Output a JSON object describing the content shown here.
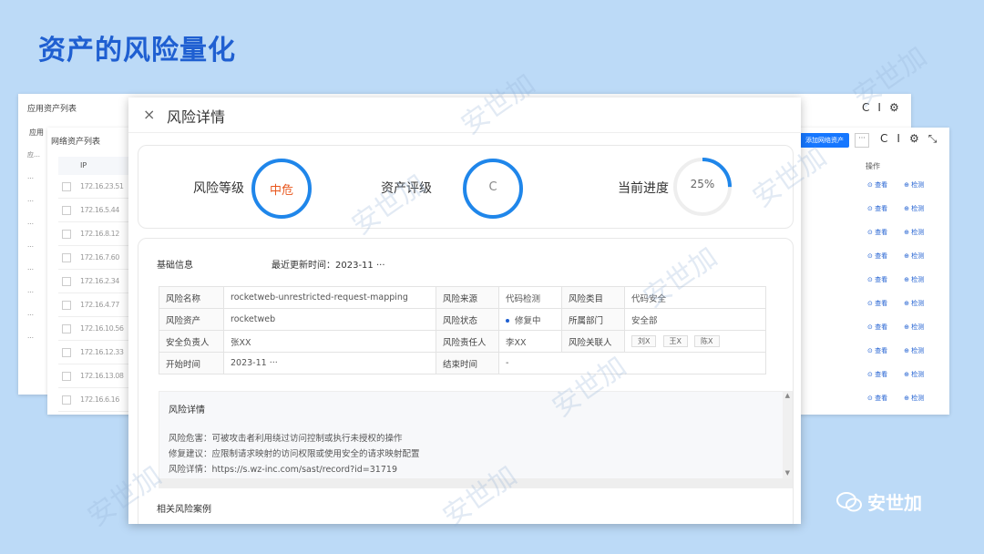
{
  "slide_title": "资产的风险量化",
  "app_list": {
    "title": "应用资产列表",
    "header": "应用",
    "rows": [
      "应…",
      "…",
      "…",
      "…",
      "…",
      "…",
      "…",
      "…",
      "…"
    ]
  },
  "net_list": {
    "title": "网络资产列表",
    "add_button": "添加网络资产",
    "more_button": "···",
    "ip_header": "IP",
    "ops_header": "操作",
    "ips": [
      "172.16.23.51",
      "172.16.5.44",
      "172.16.8.12",
      "172.16.7.60",
      "172.16.2.34",
      "172.16.4.77",
      "172.16.10.56",
      "172.16.12.33",
      "172.16.13.08",
      "172.16.6.16"
    ],
    "op_view": "⊙ 查看",
    "op_detect": "⊕ 检测"
  },
  "modal": {
    "close": "×",
    "title": "风险详情",
    "summary": {
      "level_label": "风险等级",
      "level_value": "中危",
      "level_color": "#e8561c",
      "asset_label": "资产评级",
      "asset_value": "C",
      "progress_label": "当前进度",
      "progress_value": "25%",
      "progress": 0.25
    },
    "basic": {
      "title": "基础信息",
      "updated": "最近更新时间：2023-11 ···",
      "rows": [
        {
          "k1": "风险名称",
          "v1": "rocketweb-unrestricted-request-mapping",
          "k2": "风险来源",
          "v2": "代码检测",
          "k3": "风险类目",
          "v3": "代码安全"
        },
        {
          "k1": "风险资产",
          "v1": "rocketweb",
          "k2": "风险状态",
          "v2": "修复中",
          "k3": "所属部门",
          "v3": "安全部"
        },
        {
          "k1": "安全负责人",
          "v1": "张XX",
          "k2": "风险责任人",
          "v2": "李XX",
          "k3": "风险关联人",
          "v3": ""
        },
        {
          "k1": "开始时间",
          "v1": "2023-11 ···",
          "k2": "结束时间",
          "v2": "-"
        }
      ],
      "tags": [
        "刘X",
        "王X",
        "陈X"
      ]
    },
    "detail": {
      "title": "风险详情",
      "harm": "风险危害：可被攻击者利用绕过访问控制或执行未授权的操作",
      "advice": "修复建议：应限制请求映射的访问权限或使用安全的请求映射配置",
      "link": "风险详情：https://s.wz-inc.com/sast/record?id=31719"
    },
    "related": "相关风险案例"
  },
  "window_icons": [
    "C",
    "I",
    "⚙"
  ],
  "net_icons": [
    "C",
    "I",
    "⚙",
    "⤡"
  ],
  "watermark": "安世加",
  "logo_text": "安世加",
  "colors": {
    "accent": "#1f86ea",
    "title": "#1f5fd1",
    "background": "#bcdaf7"
  }
}
